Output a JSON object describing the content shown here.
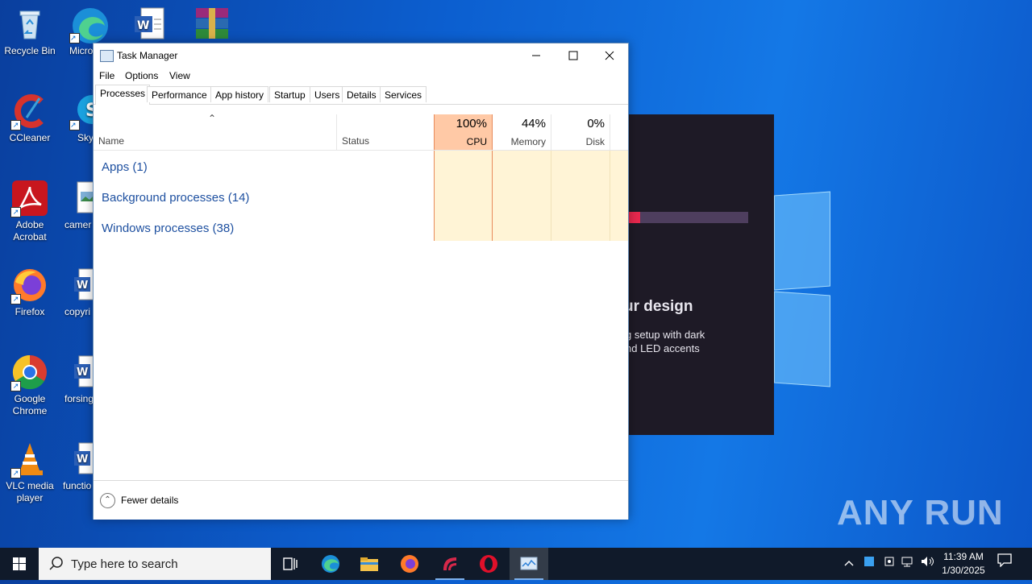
{
  "desktop": {
    "icons": [
      {
        "label": "Recycle Bin"
      },
      {
        "label": "Micro Edg"
      },
      {
        "label": "CCleaner"
      },
      {
        "label": "Sky"
      },
      {
        "label": "Adobe Acrobat"
      },
      {
        "label": "camer"
      },
      {
        "label": "Firefox"
      },
      {
        "label": "copyri"
      },
      {
        "label": "Google Chrome"
      },
      {
        "label": "forsing"
      },
      {
        "label": "VLC media player"
      },
      {
        "label": "functio"
      }
    ],
    "background_panel": {
      "heading": "ur design",
      "text": "g setup with dark\nnd LED accents"
    },
    "watermark": "ANY RUN"
  },
  "task_manager": {
    "title": "Task Manager",
    "menu": [
      "File",
      "Options",
      "View"
    ],
    "tabs": [
      "Processes",
      "Performance",
      "App history",
      "Startup",
      "Users",
      "Details",
      "Services"
    ],
    "active_tab": "Processes",
    "columns": {
      "name": "Name",
      "status": "Status",
      "cpu": {
        "pct": "100%",
        "label": "CPU"
      },
      "memory": {
        "pct": "44%",
        "label": "Memory"
      },
      "disk": {
        "pct": "0%",
        "label": "Disk"
      }
    },
    "groups": [
      "Apps (1)",
      "Background processes (14)",
      "Windows processes (38)"
    ],
    "footer": "Fewer details"
  },
  "taskbar": {
    "search_placeholder": "Type here to search",
    "clock_time": "11:39 AM",
    "clock_date": "1/30/2025"
  },
  "colors": {
    "cpu_header": "#ffc9a6",
    "cell_shade": "#fff4d6",
    "group_text": "#1e50a0"
  }
}
